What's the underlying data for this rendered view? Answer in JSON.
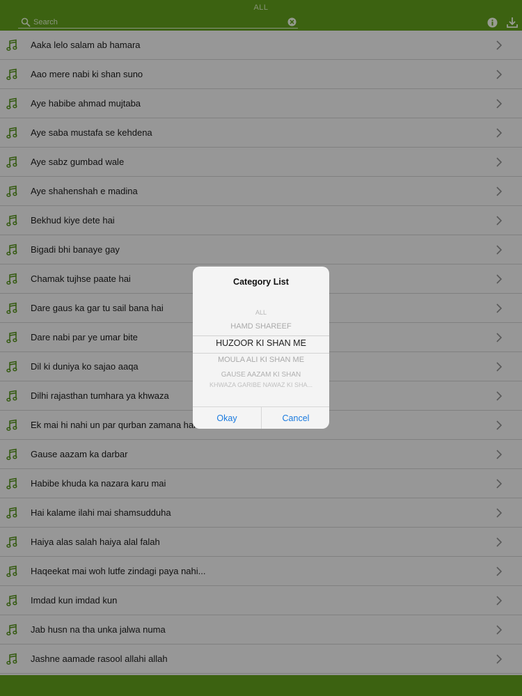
{
  "header": {
    "title": "ALL",
    "search_placeholder": "Search"
  },
  "icons": {
    "search": "magnifier-icon",
    "clear": "clear-x-icon",
    "info": "info-icon",
    "download": "download-icon",
    "row": "music-note-icon",
    "chevron": "chevron-right-icon"
  },
  "colors": {
    "brand_green": "#5e9a1c",
    "accent_blue": "#1a7adf"
  },
  "songs": [
    "Aaka lelo salam ab hamara",
    "Aao mere nabi ki shan suno",
    "Aye habibe ahmad mujtaba",
    "Aye saba mustafa se kehdena",
    "Aye sabz gumbad wale",
    "Aye shahenshah e madina",
    "Bekhud kiye dete hai",
    "Bigadi bhi banaye gay",
    "Chamak tujhse paate hai",
    "Dare gaus ka gar tu sail bana hai",
    "Dare nabi par ye umar bite",
    "Dil ki duniya ko sajao aaqa",
    "Dilhi rajasthan tumhara ya khwaza",
    "Ek mai hi nahi un par qurban zamana hai",
    "Gause aazam ka darbar",
    "Habibe khuda ka nazara karu mai",
    "Hai kalame ilahi mai shamsudduha",
    "Haiya alas salah haiya alal falah",
    "Haqeekat mai woh lutfe zindagi paya nahi...",
    "Imdad kun imdad kun",
    "Jab husn na tha unka jalwa numa",
    "Jashne aamade rasool allahi allah"
  ],
  "dialog": {
    "title": "Category List",
    "options": [
      "ALL",
      "HAMD SHAREEF",
      "HUZOOR KI SHAN ME",
      "MOULA ALI KI SHAN ME",
      "GAUSE AAZAM KI SHAN",
      "KHWAZA GARIBE NAWAZ KI SHA..."
    ],
    "selected": "HUZOOR KI SHAN ME",
    "ok_label": "Okay",
    "cancel_label": "Cancel"
  }
}
